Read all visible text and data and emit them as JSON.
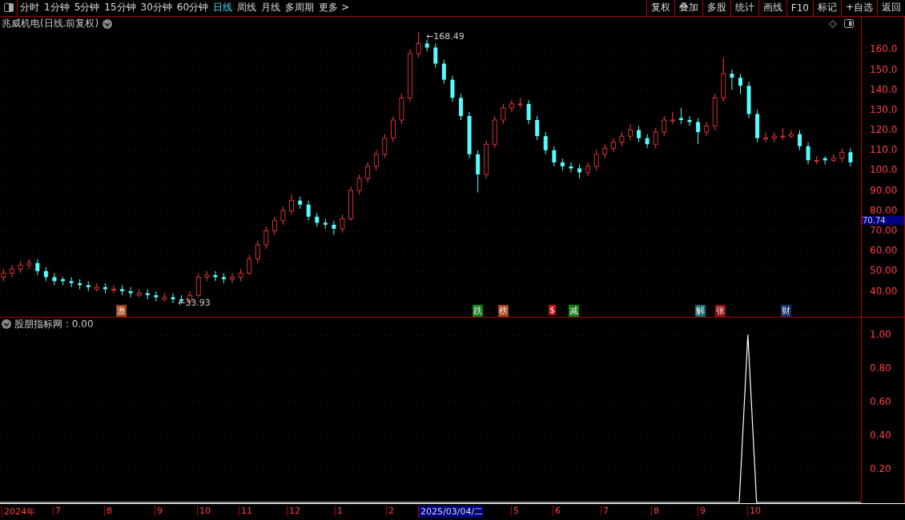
{
  "toolbar": {
    "periods": [
      {
        "label": "分时",
        "selected": false
      },
      {
        "label": "1分钟",
        "selected": false
      },
      {
        "label": "5分钟",
        "selected": false
      },
      {
        "label": "15分钟",
        "selected": false
      },
      {
        "label": "30分钟",
        "selected": false
      },
      {
        "label": "60分钟",
        "selected": false
      },
      {
        "label": "日线",
        "selected": true
      },
      {
        "label": "周线",
        "selected": false
      },
      {
        "label": "月线",
        "selected": false
      },
      {
        "label": "多周期",
        "selected": false
      },
      {
        "label": "更多 >",
        "selected": false
      }
    ],
    "actions": [
      "复权",
      "叠加",
      "多股",
      "统计",
      "画线",
      "F10",
      "标记",
      "+自选",
      "返回"
    ]
  },
  "chart": {
    "title": "兆威机电(日线.前复权)",
    "high_label": "←168.49",
    "low_label": "←33.93",
    "current_price": "70.74",
    "chart_data": {
      "type": "candlestick",
      "grid": true,
      "ylim": [
        27.3,
        169.1
      ],
      "yticks": [
        {
          "value": 160,
          "label": "160.0"
        },
        {
          "value": 150,
          "label": "150.0"
        },
        {
          "value": 140,
          "label": "140.0"
        },
        {
          "value": 130,
          "label": "130.0"
        },
        {
          "value": 120,
          "label": "120.0"
        },
        {
          "value": 110,
          "label": "110.0"
        },
        {
          "value": 100,
          "label": "100.0"
        },
        {
          "value": 90,
          "label": "90.00"
        },
        {
          "value": 80,
          "label": "80.00"
        },
        {
          "value": 70,
          "label": "70.00"
        },
        {
          "value": 60,
          "label": "60.00"
        },
        {
          "value": 50,
          "label": "50.00"
        },
        {
          "value": 40,
          "label": "40.00"
        }
      ],
      "ohlc": [
        [
          47,
          51,
          45,
          49
        ],
        [
          49,
          53,
          47,
          51
        ],
        [
          51,
          55,
          49,
          53
        ],
        [
          53,
          56,
          51,
          54
        ],
        [
          54,
          56,
          48,
          50
        ],
        [
          50,
          52,
          45,
          47
        ],
        [
          47,
          49,
          43,
          45
        ],
        [
          46,
          47,
          43,
          45
        ],
        [
          45,
          47,
          42,
          44
        ],
        [
          44,
          46,
          41,
          43
        ],
        [
          43,
          45,
          40,
          42
        ],
        [
          41,
          44,
          40,
          42
        ],
        [
          42,
          44,
          39,
          41
        ],
        [
          41,
          43,
          39,
          41
        ],
        [
          41,
          43,
          38,
          40
        ],
        [
          40,
          42,
          37,
          39
        ],
        [
          38,
          41,
          37,
          39
        ],
        [
          39,
          41,
          36,
          38
        ],
        [
          38,
          40,
          35,
          37
        ],
        [
          36,
          39,
          35,
          37
        ],
        [
          37,
          39,
          34,
          36
        ],
        [
          36,
          38,
          33.93,
          35
        ],
        [
          35,
          40,
          34,
          38
        ],
        [
          38,
          49,
          37,
          47
        ],
        [
          47,
          50,
          45,
          48
        ],
        [
          48,
          50,
          45,
          47
        ],
        [
          47,
          49,
          44,
          46
        ],
        [
          46,
          49,
          44,
          47
        ],
        [
          47,
          51,
          45,
          49
        ],
        [
          49,
          58,
          48,
          56
        ],
        [
          56,
          65,
          54,
          63
        ],
        [
          63,
          72,
          61,
          70
        ],
        [
          70,
          77,
          68,
          75
        ],
        [
          75,
          82,
          73,
          80
        ],
        [
          80,
          88,
          78,
          85
        ],
        [
          85,
          87,
          81,
          83
        ],
        [
          83,
          85,
          75,
          77
        ],
        [
          77,
          79,
          72,
          74
        ],
        [
          74,
          76,
          71,
          73
        ],
        [
          73,
          75,
          68,
          71
        ],
        [
          71,
          78,
          69,
          76
        ],
        [
          76,
          92,
          75,
          90
        ],
        [
          90,
          98,
          88,
          96
        ],
        [
          96,
          104,
          94,
          102
        ],
        [
          102,
          110,
          100,
          108
        ],
        [
          108,
          118,
          106,
          116
        ],
        [
          116,
          127,
          114,
          125
        ],
        [
          125,
          138,
          123,
          136
        ],
        [
          136,
          160,
          134,
          158
        ],
        [
          158,
          168.49,
          156,
          163
        ],
        [
          163,
          165,
          159,
          161
        ],
        [
          161,
          163,
          151,
          153
        ],
        [
          153,
          155,
          143,
          145
        ],
        [
          145,
          147,
          134,
          136
        ],
        [
          136,
          138,
          125,
          127
        ],
        [
          127,
          129,
          106,
          108
        ],
        [
          108,
          110,
          89,
          98
        ],
        [
          98,
          115,
          96,
          113
        ],
        [
          113,
          127,
          111,
          125
        ],
        [
          125,
          133,
          123,
          131
        ],
        [
          131,
          135,
          129,
          133
        ],
        [
          133,
          136,
          131,
          133
        ],
        [
          133,
          135,
          123,
          125
        ],
        [
          125,
          127,
          115,
          117
        ],
        [
          117,
          119,
          108,
          110
        ],
        [
          110,
          112,
          102,
          104
        ],
        [
          104,
          106,
          100,
          102
        ],
        [
          102,
          104,
          99,
          101
        ],
        [
          101,
          103,
          96,
          99
        ],
        [
          99,
          104,
          97,
          102
        ],
        [
          102,
          110,
          100,
          108
        ],
        [
          108,
          113,
          106,
          111
        ],
        [
          111,
          116,
          109,
          114
        ],
        [
          114,
          119,
          112,
          117
        ],
        [
          117,
          123,
          115,
          120
        ],
        [
          120,
          122,
          114,
          116
        ],
        [
          116,
          118,
          111,
          113
        ],
        [
          113,
          121,
          111,
          119
        ],
        [
          119,
          127,
          117,
          125
        ],
        [
          125,
          129,
          123,
          125
        ],
        [
          126,
          131,
          123,
          125
        ],
        [
          125,
          127,
          122,
          124
        ],
        [
          124,
          126,
          113,
          119
        ],
        [
          119,
          124,
          117,
          122
        ],
        [
          122,
          138,
          120,
          136
        ],
        [
          136,
          156,
          134,
          148
        ],
        [
          148,
          150,
          140,
          146
        ],
        [
          146,
          148,
          138,
          142
        ],
        [
          142,
          144,
          126,
          128
        ],
        [
          128,
          130,
          114,
          116
        ],
        [
          116,
          119,
          114,
          116
        ],
        [
          116,
          119,
          114,
          117
        ],
        [
          117,
          121,
          115,
          117
        ],
        [
          117,
          120,
          116,
          118
        ],
        [
          118,
          120,
          110,
          112
        ],
        [
          112,
          114,
          103,
          105
        ],
        [
          105,
          107,
          103,
          105
        ],
        [
          106,
          107,
          103,
          105
        ],
        [
          105,
          108,
          104,
          106
        ],
        [
          106,
          111,
          104,
          109
        ],
        [
          109,
          111,
          102,
          104
        ]
      ]
    },
    "events": [
      {
        "label": "激",
        "color": "#a04010"
      },
      {
        "label": "跌",
        "color": "#108010"
      },
      {
        "label": "榜",
        "color": "#a04010"
      },
      {
        "label": "$",
        "color": "#c01010"
      },
      {
        "label": "减",
        "color": "#108010"
      },
      {
        "label": "解",
        "color": "#107070"
      },
      {
        "label": "张",
        "color": "#901010"
      },
      {
        "label": "财",
        "color": "#103070"
      }
    ]
  },
  "indicator": {
    "reading": ": 0.00",
    "chart_data": {
      "type": "line",
      "grid": true,
      "ylim": [
        0,
        1.02
      ],
      "yticks": [
        {
          "value": 1,
          "label": "1.00"
        },
        {
          "value": 0.8,
          "label": "0.80"
        },
        {
          "value": 0.6,
          "label": "0.60"
        },
        {
          "value": 0.4,
          "label": "0.40"
        },
        {
          "value": 0.2,
          "label": "0.20"
        }
      ],
      "series": [
        {
          "name": "股朋指标网",
          "color": "#ffffff",
          "values": [
            0,
            0,
            0,
            0,
            0,
            0,
            0,
            0,
            0,
            0,
            0,
            0,
            0,
            0,
            0,
            0,
            0,
            0,
            0,
            0,
            0,
            0,
            0,
            0,
            0,
            0,
            0,
            0,
            0,
            0,
            0,
            0,
            0,
            0,
            0,
            0,
            0,
            0,
            0,
            0,
            0,
            0,
            0,
            0,
            0,
            0,
            0,
            0,
            0,
            0,
            0,
            0,
            0,
            0,
            0,
            0,
            0,
            0,
            0,
            0,
            0,
            0,
            0,
            0,
            0,
            0,
            0,
            0,
            0,
            0,
            0,
            0,
            0,
            0,
            0,
            0,
            0,
            0,
            0,
            0,
            0,
            0,
            0,
            0,
            0,
            0,
            1,
            0,
            0,
            0,
            0,
            0,
            0,
            0,
            0,
            0,
            0,
            0,
            0,
            0
          ]
        }
      ]
    }
  },
  "date_axis": {
    "labels": [
      {
        "label": "2024年",
        "selected": false
      },
      {
        "label": "7",
        "selected": false
      },
      {
        "label": "8",
        "selected": false
      },
      {
        "label": "9",
        "selected": false
      },
      {
        "label": "10",
        "selected": false
      },
      {
        "label": "11",
        "selected": false
      },
      {
        "label": "12",
        "selected": false
      },
      {
        "label": "1",
        "selected": false
      },
      {
        "label": "2",
        "selected": false
      },
      {
        "label": "2025/03/04/二",
        "selected": true
      },
      {
        "label": "5",
        "selected": false
      },
      {
        "label": "6",
        "selected": false
      },
      {
        "label": "7",
        "selected": false
      },
      {
        "label": "8",
        "selected": false
      },
      {
        "label": "9",
        "selected": false
      },
      {
        "label": "10",
        "selected": false
      }
    ]
  }
}
